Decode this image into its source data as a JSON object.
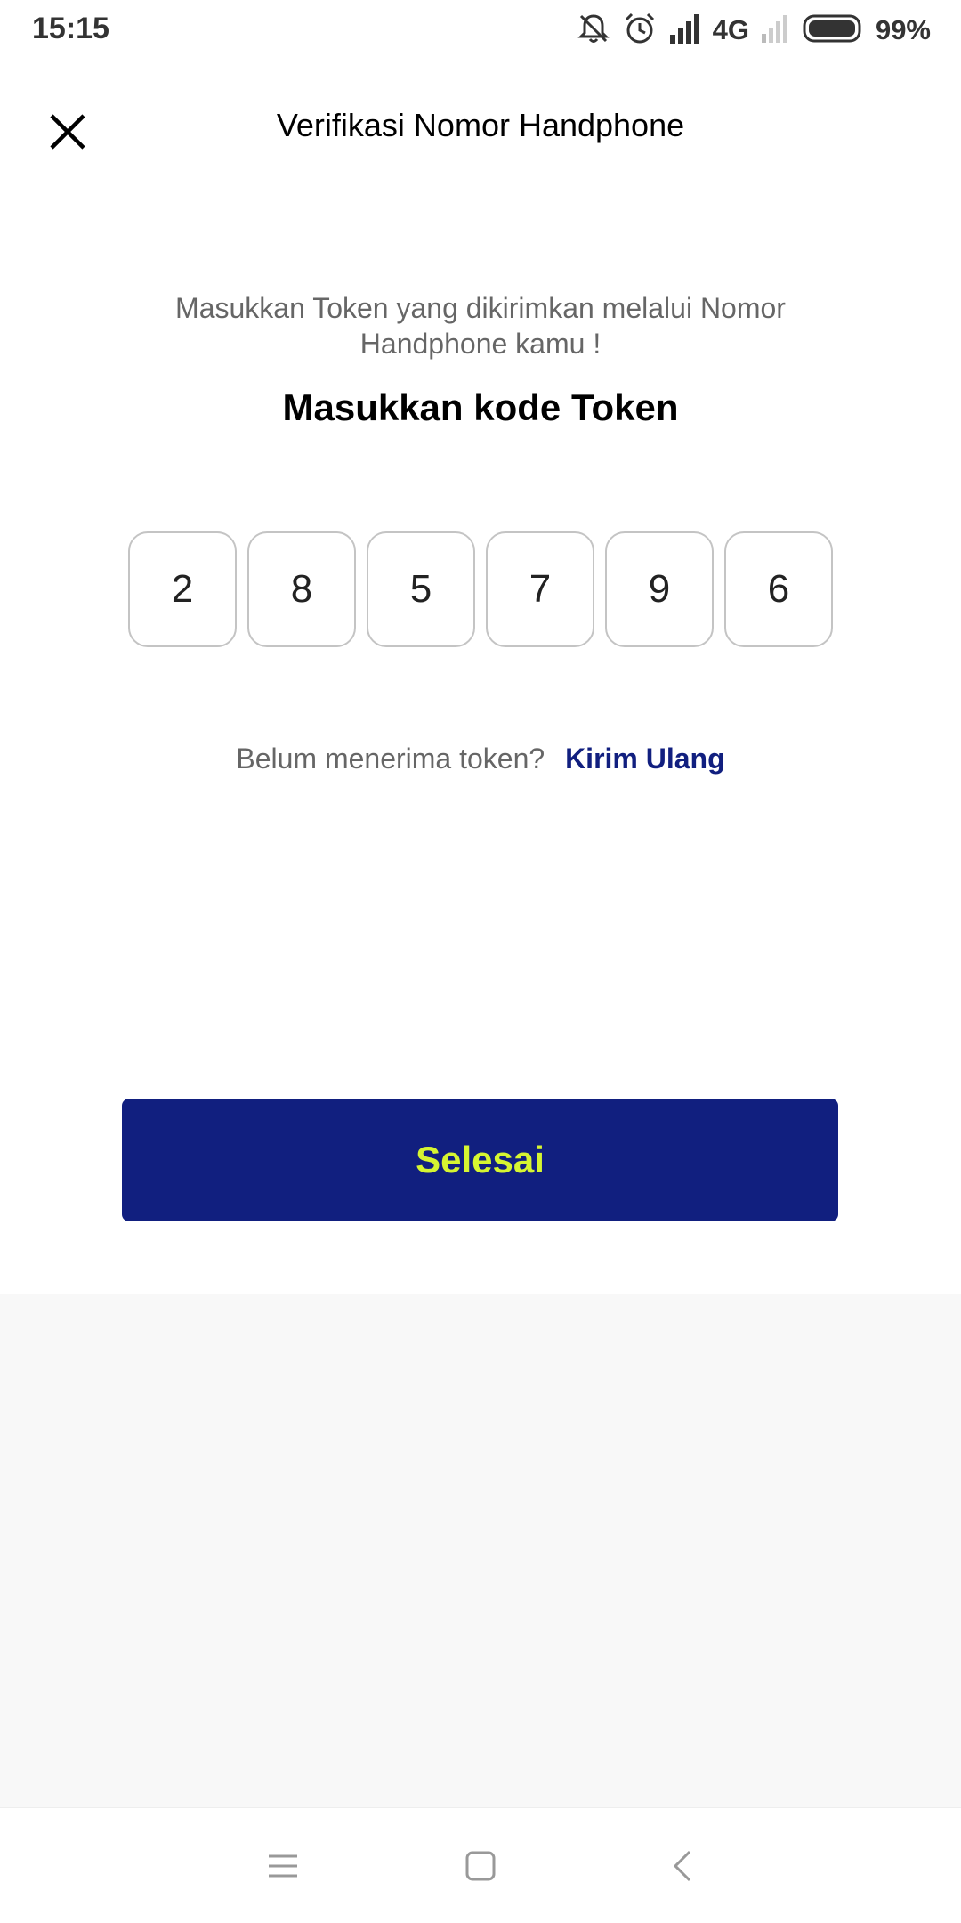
{
  "status_bar": {
    "time": "15:15",
    "network": "4G",
    "battery": "99%",
    "icons": [
      "notifications-off-icon",
      "alarm-icon",
      "signal-icon",
      "signal-weak-icon",
      "battery-icon"
    ]
  },
  "header": {
    "title": "Verifikasi Nomor Handphone",
    "close_icon": "close-icon"
  },
  "content": {
    "instruction": "Masukkan Token yang dikirimkan melalui Nomor Handphone kamu !",
    "token_title": "Masukkan kode Token",
    "otp_digits": [
      "2",
      "8",
      "5",
      "7",
      "9",
      "6"
    ],
    "resend_question": "Belum menerima token?",
    "resend_link": "Kirim Ulang"
  },
  "actions": {
    "done_label": "Selesai"
  },
  "nav_bar": {
    "icons": [
      "menu-icon",
      "home-icon",
      "back-icon"
    ]
  },
  "colors": {
    "primary": "#111f7f",
    "button_text": "#d6f531",
    "muted_text": "#666666",
    "otp_border": "#c4c4c4",
    "background_grey": "#f8f8f8"
  }
}
